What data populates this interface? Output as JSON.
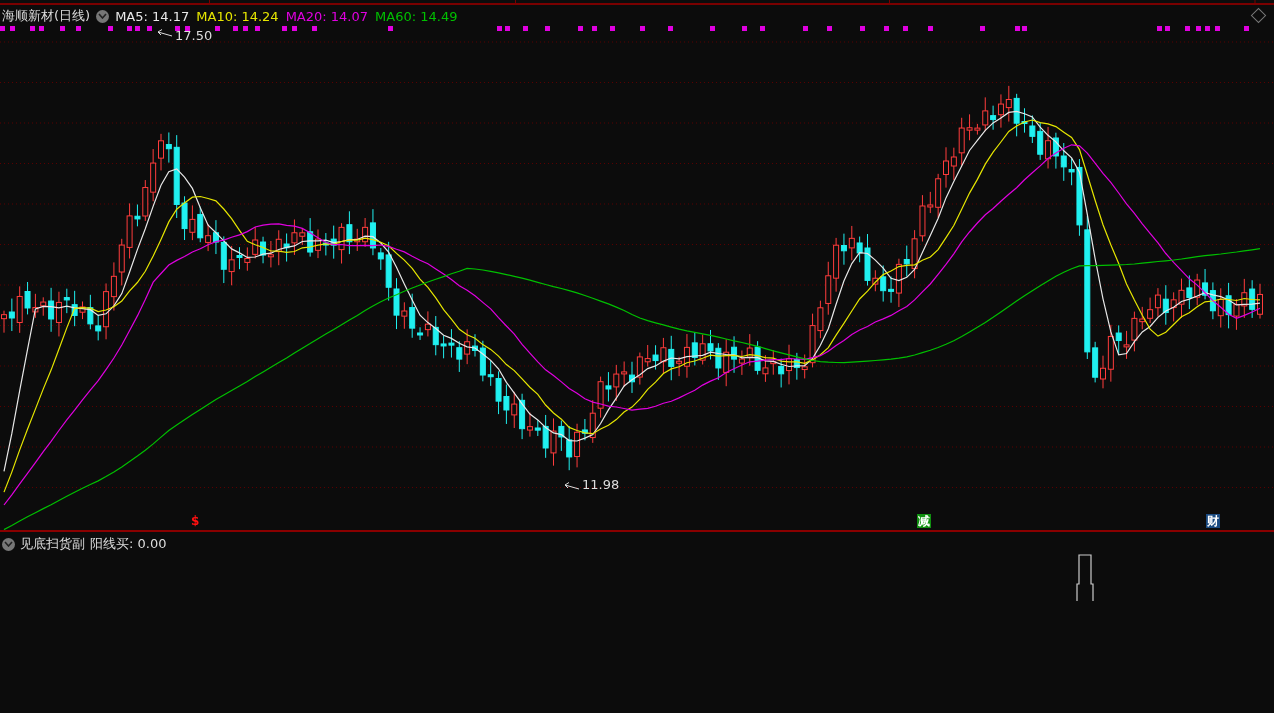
{
  "main_panel": {
    "title": "海顺新材(日线)",
    "moving_averages": [
      {
        "label": "MA5: 14.17",
        "color": "#e8e8e8"
      },
      {
        "label": "MA10: 14.24",
        "color": "#e6e600"
      },
      {
        "label": "MA20: 14.07",
        "color": "#e000e0"
      },
      {
        "label": "MA60: 14.49",
        "color": "#00c000"
      }
    ],
    "price_labels": [
      {
        "kind": "high",
        "text": "17.50"
      },
      {
        "kind": "low",
        "text": "11.98"
      }
    ],
    "markers": [
      {
        "kind": "dollar",
        "text": "$"
      },
      {
        "kind": "reduce",
        "text": "减"
      },
      {
        "kind": "finance",
        "text": "财"
      }
    ]
  },
  "sub_panel": {
    "title": "见底扫货副",
    "reading": "阳线买: 0.00"
  }
}
